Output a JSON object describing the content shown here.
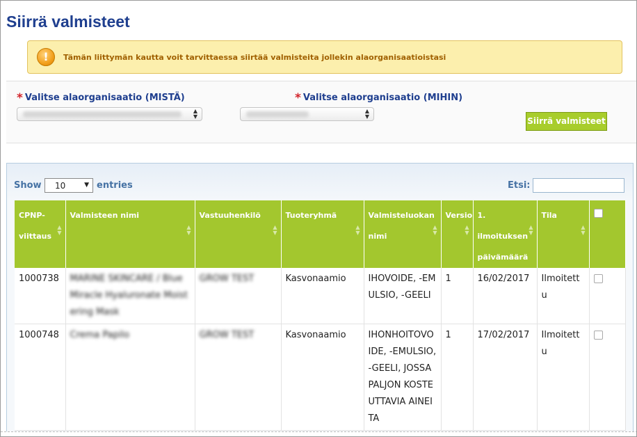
{
  "page": {
    "title": "Siirrä valmisteet",
    "warning": "Tämän liittymän kautta voit tarvittaessa siirtää valmisteita jollekin alaorganisaatioistasi"
  },
  "org_select": {
    "from_label": "Valitse alaorganisaatio (MISTÄ)",
    "from_value": "GROW TEST Subenq (change of name)",
    "to_label": "Valitse alaorganisaatio (MIHIN)",
    "to_value": "GROW TEST",
    "required_mark": "*",
    "move_button": "Siirrä valmisteet"
  },
  "list": {
    "show_label": "Show",
    "entries_value": "10",
    "entries_label": "entries",
    "search_label": "Etsi:",
    "columns": [
      "CPNP-viittaus",
      "Valmisteen nimi",
      "Vastuuhenkilö",
      "Tuoteryhmä",
      "Valmisteluokan nimi",
      "Versio",
      "1. ilmoituksen päivämäärä",
      "Tila"
    ],
    "rows": [
      {
        "cpnp": "1000738",
        "name": "MARINE SKINCARE / BlueMiracle Hyaluronate Moistering Mask",
        "person": "GROW TEST",
        "group": "Kasvonaamio",
        "category": "IHOVOIDE, -EMULSIO, -GEELI",
        "version": "1",
        "date": "16/02/2017",
        "status": "Ilmoitettu"
      },
      {
        "cpnp": "1000748",
        "name": "Crema Papilo",
        "person": "GROW TEST",
        "group": "Kasvonaamio",
        "category": "IHONHOITOVOIDE, -EMULSIO, -GEELI, JOSSA PALJON KOSTEUTTAVIA AINEITA",
        "version": "1",
        "date": "17/02/2017",
        "status": "Ilmoitettu"
      }
    ]
  },
  "colors": {
    "title_blue": "#1f3f8f",
    "header_green": "#a3c72e",
    "warning_bg": "#fcefad",
    "button_green": "#a8cd2c"
  }
}
